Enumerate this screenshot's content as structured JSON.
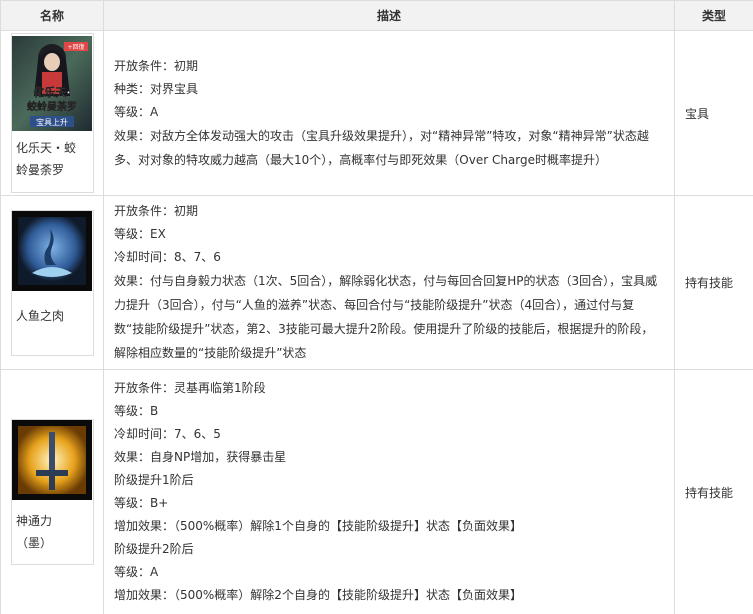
{
  "headers": {
    "name": "名称",
    "desc": "描述",
    "type": "类型"
  },
  "rows": [
    {
      "name": "化乐天・蛟蛉曼荼罗",
      "name_line1": "化乐天・蛟",
      "name_line2": "蛉曼荼罗",
      "image_text": {
        "badge": "+回復",
        "title1": "化乐天·",
        "title2": "蛟蛉曼荼罗",
        "sub": "宝具上升"
      },
      "lines": [
        "开放条件：初期",
        "种类：对界宝具",
        "等级：A",
        "效果：对敌方全体发动强大的攻击（宝具升级效果提升），对“精神异常”特攻，对象“精神异常”状态越多、对对象的特攻威力越高（最大10个），高概率付与即死效果（Over Charge时概率提升）"
      ],
      "type": "宝具"
    },
    {
      "name": "人鱼之肉",
      "lines": [
        "开放条件：初期",
        "等级：EX",
        "冷却时间：8、7、6",
        "效果：付与自身毅力状态（1次、5回合），解除弱化状态，付与每回合回复HP的状态（3回合），宝具威力提升（3回合），付与“人鱼的滋养”状态、每回合付与“技能阶级提升”状态（4回合），通过付与复数“技能阶级提升”状态，第2、3技能可最大提升2阶段。使用提升了阶级的技能后，根据提升的阶段，解除相应数量的“技能阶级提升”状态"
      ],
      "type": "持有技能"
    },
    {
      "name": "神通力（墨）",
      "name_line1": "神通力",
      "name_line2": "（墨）",
      "lines": [
        "开放条件：灵基再临第1阶段",
        "等级：B",
        "冷却时间：7、6、5",
        "效果：自身NP增加，获得暴击星",
        "阶级提升1阶后",
        "等级：B+",
        "增加效果：（500%概率）解除1个自身的【技能阶级提升】状态【负面效果】",
        "阶级提升2阶后",
        "等级：A",
        "增加效果：（500%概率）解除2个自身的【技能阶级提升】状态【负面效果】"
      ],
      "type": "持有技能"
    }
  ],
  "colors": {
    "header_bg": "#f2f2f2",
    "border": "#dcdcdc",
    "text": "#333333"
  }
}
